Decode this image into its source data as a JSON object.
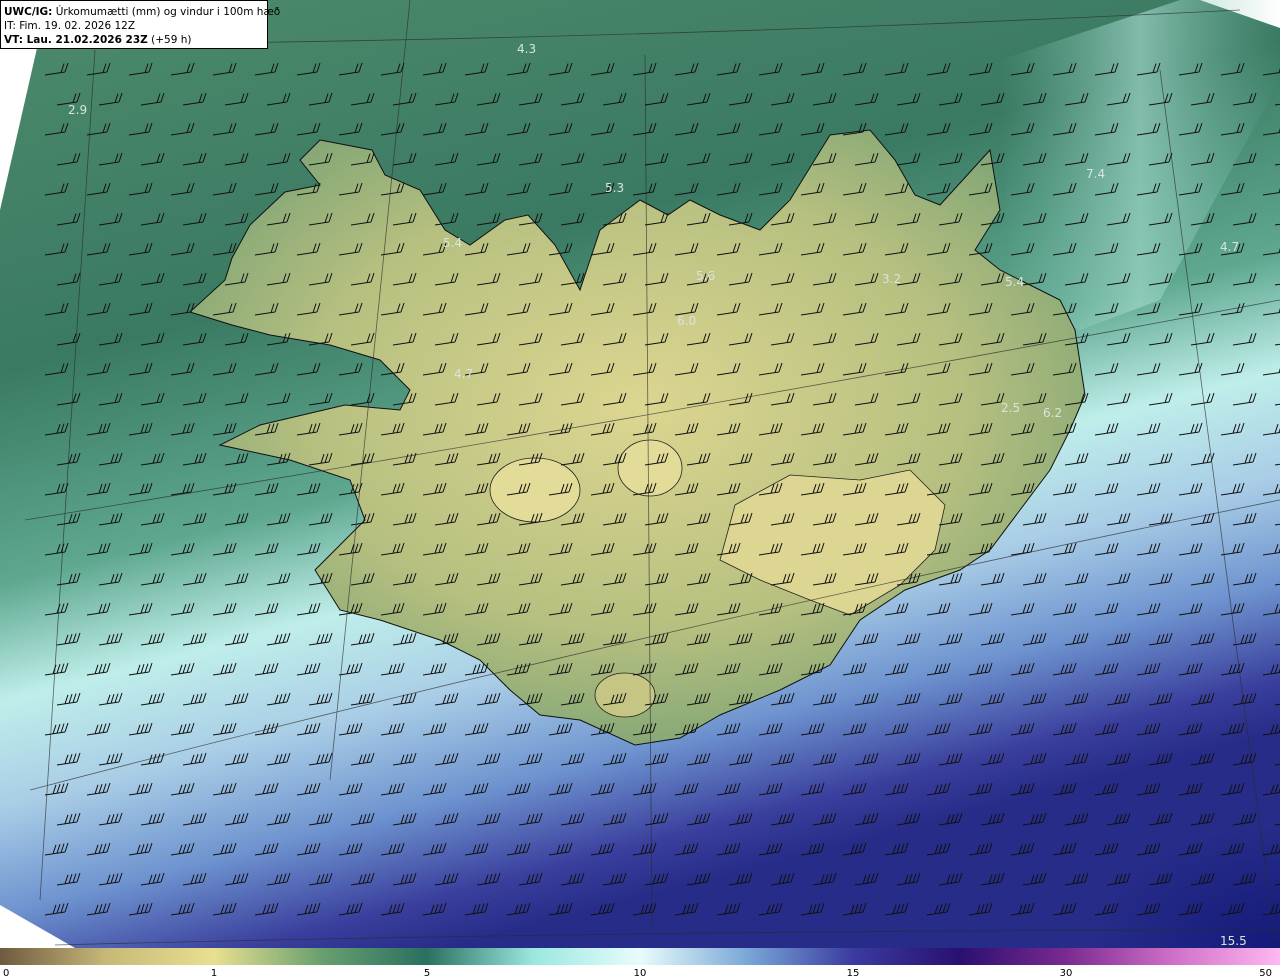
{
  "header": {
    "model": "UWC/IG:",
    "title": "Úrkomumætti (mm) og vindur i 100m hæð",
    "it": "IT: Fim. 19. 02. 2026 12Z",
    "vt_prefix": "VT: Lau. 21.02.2026 23Z",
    "vt_suffix": "(+59 h)"
  },
  "map_labels": [
    {
      "text": "4.3"
    },
    {
      "text": "2.9"
    },
    {
      "text": "5.3"
    },
    {
      "text": "5.4"
    },
    {
      "text": "7.4"
    },
    {
      "text": "4.7"
    },
    {
      "text": "5.6"
    },
    {
      "text": "3.2"
    },
    {
      "text": "5.4"
    },
    {
      "text": "6.0"
    },
    {
      "text": "4.7"
    },
    {
      "text": "2.5"
    },
    {
      "text": "6.2"
    },
    {
      "text": "15.5"
    }
  ],
  "colorbar": {
    "ticks": [
      "0",
      "1",
      "5",
      "10",
      "15",
      "30",
      "50"
    ],
    "colors": [
      "#6e5a40",
      "#c8b878",
      "#e8e090",
      "#6aa070",
      "#2a7060",
      "#9ae8e0",
      "#e8fcfc",
      "#7aa8d8",
      "#3a3aa0",
      "#2a1070",
      "#7a2a90",
      "#d070c8",
      "#ffb8f0"
    ]
  },
  "colors": {
    "land_low": "#d8d38a",
    "sea_green": "#3e7e66",
    "sea_deep": "#2d6a55",
    "cyan": "#bfeeea",
    "blue": "#6f9ad0",
    "navy": "#2f2f8e"
  }
}
